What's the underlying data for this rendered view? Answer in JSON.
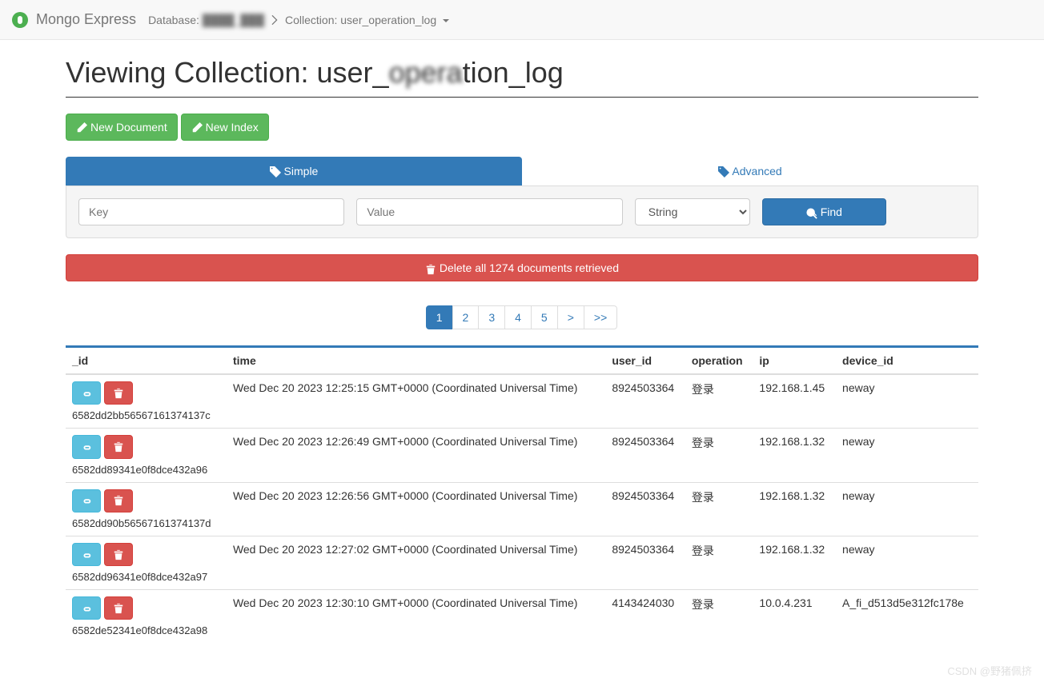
{
  "navbar": {
    "brand": "Mongo Express",
    "database_label": "Database:",
    "database_name": "████_███",
    "collection_label": "Collection:",
    "collection_name": "user_operation_log"
  },
  "heading": {
    "prefix": "Viewing Collection: user_",
    "blur": "opera",
    "suffix": "tion_log"
  },
  "buttons": {
    "new_document": "New Document",
    "new_index": "New Index",
    "find": "Find",
    "delete_all": "Delete all 1274 documents retrieved"
  },
  "tabs": {
    "simple": "Simple",
    "advanced": "Advanced"
  },
  "search": {
    "key_placeholder": "Key",
    "value_placeholder": "Value",
    "type_options": [
      "String"
    ],
    "type_selected": "String"
  },
  "pagination": [
    "1",
    "2",
    "3",
    "4",
    "5",
    ">",
    ">>"
  ],
  "table": {
    "headers": [
      "_id",
      "time",
      "user_id",
      "operation",
      "ip",
      "device_id"
    ],
    "rows": [
      {
        "id": "6582dd2bb56567161374137c",
        "time": "Wed Dec 20 2023 12:25:15 GMT+0000 (Coordinated Universal Time)",
        "user_id": "8924503364",
        "operation": "登录",
        "ip": "192.168.1.45",
        "device_id": "neway"
      },
      {
        "id": "6582dd89341e0f8dce432a96",
        "time": "Wed Dec 20 2023 12:26:49 GMT+0000 (Coordinated Universal Time)",
        "user_id": "8924503364",
        "operation": "登录",
        "ip": "192.168.1.32",
        "device_id": "neway"
      },
      {
        "id": "6582dd90b56567161374137d",
        "time": "Wed Dec 20 2023 12:26:56 GMT+0000 (Coordinated Universal Time)",
        "user_id": "8924503364",
        "operation": "登录",
        "ip": "192.168.1.32",
        "device_id": "neway"
      },
      {
        "id": "6582dd96341e0f8dce432a97",
        "time": "Wed Dec 20 2023 12:27:02 GMT+0000 (Coordinated Universal Time)",
        "user_id": "8924503364",
        "operation": "登录",
        "ip": "192.168.1.32",
        "device_id": "neway"
      },
      {
        "id": "6582de52341e0f8dce432a98",
        "time": "Wed Dec 20 2023 12:30:10 GMT+0000 (Coordinated Universal Time)",
        "user_id": "4143424030",
        "operation": "登录",
        "ip": "10.0.4.231",
        "device_id": "A_fi_d513d5e312fc178e"
      }
    ]
  },
  "watermark": "CSDN @野猪佩挤"
}
